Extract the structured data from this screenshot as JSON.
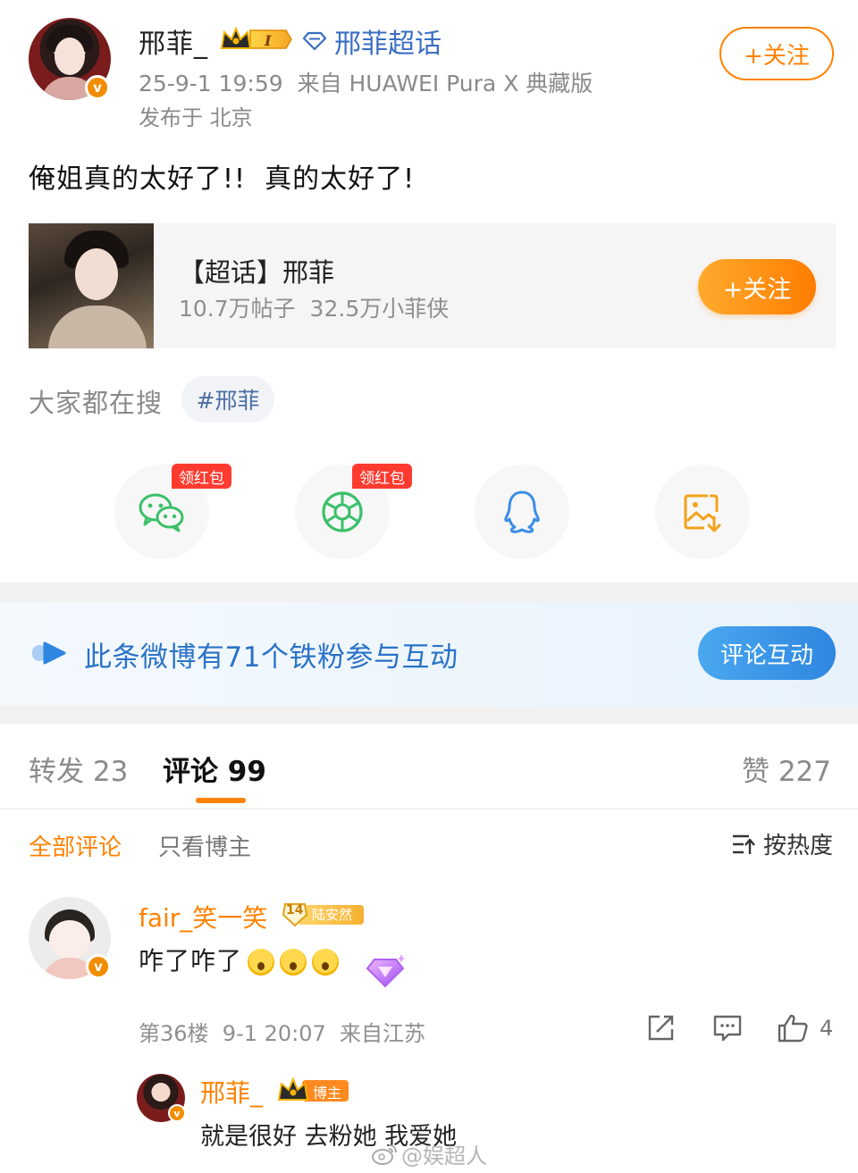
{
  "post": {
    "author_name": "邢菲_",
    "level_badge": "I",
    "supertopic_link": "邢菲超话",
    "timestamp_source": "25-9-1 19:59  来自 HUAWEI Pura X 典藏版",
    "location": "发布于 北京",
    "follow_label": "+关注",
    "text": "俺姐真的太好了!!  真的太好了!"
  },
  "topic_card": {
    "title": "【超话】邢菲",
    "stats": "10.7万帖子  32.5万小菲侠",
    "follow_label": "+关注"
  },
  "search": {
    "label": "大家都在搜",
    "tag": "#邢菲"
  },
  "share": {
    "red_packet_label": "领红包",
    "items": [
      "wechat-icon",
      "moments-icon",
      "qq-icon",
      "save-image-icon"
    ],
    "colors": {
      "wechat": "#3cc06a",
      "moments": "#3cc06a",
      "qq": "#3a8ee6",
      "save": "#f3a21a"
    }
  },
  "fans_banner": {
    "text": "此条微博有71个铁粉参与互动",
    "button": "评论互动"
  },
  "tabs": {
    "repost": "转发 23",
    "comment": "评论 99",
    "like": "赞 227"
  },
  "filters": {
    "all": "全部评论",
    "owner_only": "只看博主",
    "sort": "按热度"
  },
  "comment": {
    "author": "fair_笑一笑",
    "fan_level": "14",
    "fan_badge_name": "陆安然",
    "text": "咋了咋了",
    "meta": "第36楼  9-1 20:07  来自江苏",
    "like_count": "4"
  },
  "reply": {
    "author": "邢菲_",
    "badge": "博主",
    "text": "就是很好 去粉她 我爱她"
  },
  "watermark": "@娱超人",
  "colors": {
    "accent": "#ff8200",
    "link": "#3b6ec2",
    "banner_text": "#2a73c7"
  }
}
